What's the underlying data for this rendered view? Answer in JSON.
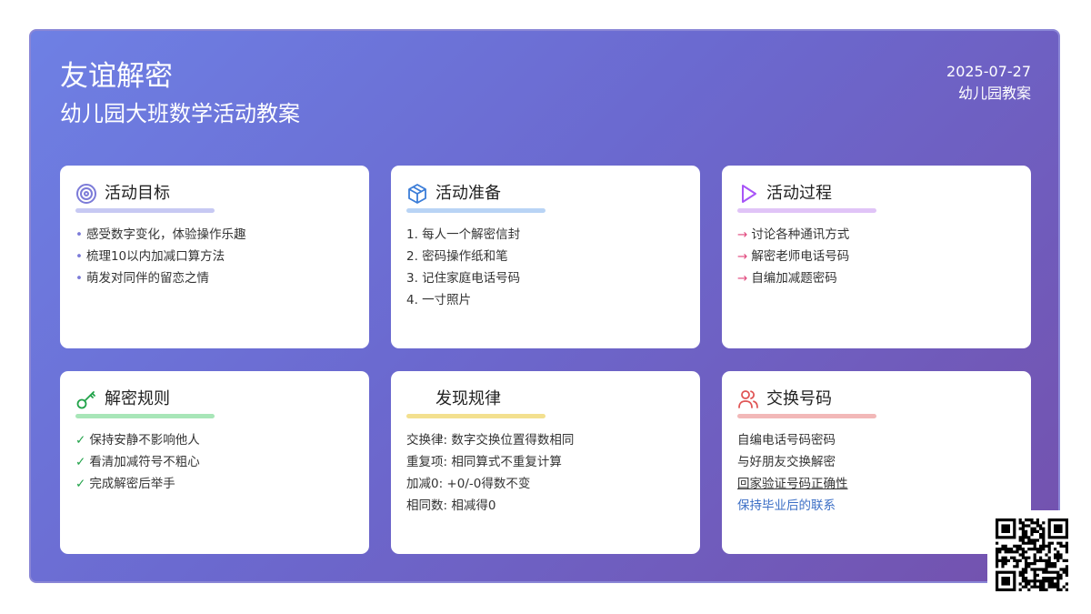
{
  "header": {
    "title": "友谊解密",
    "subtitle": "幼儿园大班数学活动教案",
    "date": "2025-07-27",
    "tag": "幼儿园教案"
  },
  "colors": {
    "goals": "#7c7bd8",
    "prep": "#3b7dd8",
    "process": "#a855f7",
    "rules": "#22a34a",
    "rules_check": "#22a34a",
    "exchange": "#e05555",
    "process_arrow": "#e0457b",
    "link_blue": "#3b6ec5"
  },
  "cards": {
    "goals": {
      "icon": "target-icon",
      "title": "活动目标",
      "items": [
        "感受数字变化，体验操作乐趣",
        "梳理10以内加减口算方法",
        "萌发对同伴的留恋之情"
      ]
    },
    "prep": {
      "icon": "box-icon",
      "title": "活动准备",
      "items": [
        "1. 每人一个解密信封",
        "2. 密码操作纸和笔",
        "3. 记住家庭电话号码",
        "4. 一寸照片"
      ]
    },
    "process": {
      "icon": "play-icon",
      "title": "活动过程",
      "items": [
        "讨论各种通讯方式",
        "解密老师电话号码",
        "自编加减题密码"
      ]
    },
    "rules": {
      "icon": "key-icon",
      "title": "解密规则",
      "items": [
        "保持安静不影响他人",
        "看清加减符号不粗心",
        "完成解密后举手"
      ]
    },
    "patterns": {
      "title": "发现规律",
      "items": [
        "交换律: 数字交换位置得数相同",
        "重复项: 相同算式不重复计算",
        "加减0: +0/-0得数不变",
        "相同数: 相减得0"
      ]
    },
    "exchange": {
      "icon": "users-icon",
      "title": "交换号码",
      "items": [
        "自编电话号码密码",
        "与好朋友交换解密",
        "回家验证号码正确性",
        "保持毕业后的联系"
      ]
    }
  },
  "qr": {
    "icon": "qr-code-icon"
  }
}
